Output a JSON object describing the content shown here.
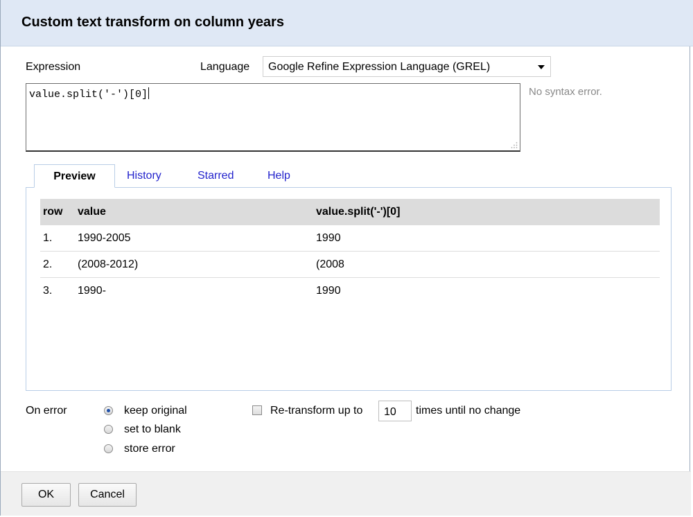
{
  "dialog": {
    "title": "Custom text transform on column years"
  },
  "expression": {
    "label": "Expression",
    "language_label": "Language",
    "language_value": "Google Refine Expression Language (GREL)",
    "value": "value.split('-')[0]",
    "syntax_status": "No syntax error."
  },
  "tabs": [
    {
      "label": "Preview",
      "active": true
    },
    {
      "label": "History",
      "active": false
    },
    {
      "label": "Starred",
      "active": false
    },
    {
      "label": "Help",
      "active": false
    }
  ],
  "preview_table": {
    "columns": [
      "row",
      "value",
      "value.split('-')[0]"
    ],
    "rows": [
      {
        "row": "1.",
        "value": "1990-2005",
        "result": "1990"
      },
      {
        "row": "2.",
        "value": "(2008-2012)",
        "result": "(2008"
      },
      {
        "row": "3.",
        "value": "1990-",
        "result": "1990"
      }
    ]
  },
  "on_error": {
    "label": "On error",
    "options": [
      {
        "label": "keep original",
        "checked": true
      },
      {
        "label": "set to blank",
        "checked": false
      },
      {
        "label": "store error",
        "checked": false
      }
    ]
  },
  "retransform": {
    "checked": false,
    "label": "Re-transform up to",
    "count": "10",
    "suffix": "times until no change"
  },
  "buttons": {
    "ok": "OK",
    "cancel": "Cancel"
  },
  "colors": {
    "title_bar": "#dfe8f5",
    "tab_link": "#2222cc",
    "table_header": "#dcdcdc",
    "footer": "#f0f0f0"
  }
}
